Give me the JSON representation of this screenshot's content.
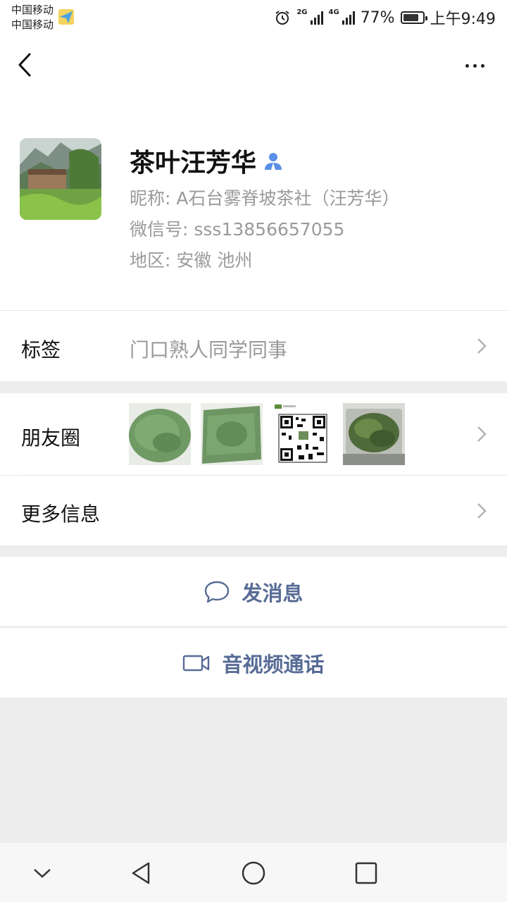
{
  "status_bar": {
    "carrier_1": "中国移动",
    "carrier_2": "中国移动",
    "network_1": "2G",
    "network_2": "4G",
    "battery_percent": "77%",
    "time": "上午9:49"
  },
  "profile": {
    "name": "茶叶汪芳华",
    "nickname": "昵称: A石台雾脊坡茶社（汪芳华）",
    "wechat_id": "微信号: sss13856657055",
    "region": "地区: 安徽  池州"
  },
  "tags": {
    "label": "标签",
    "value": "门口熟人同学同事"
  },
  "moments": {
    "label": "朋友圈"
  },
  "more_info": {
    "label": "更多信息"
  },
  "actions": {
    "send_message": "发消息",
    "video_call": "音视频通话"
  },
  "colors": {
    "link_blue": "#576b95",
    "background": "#ededed"
  }
}
